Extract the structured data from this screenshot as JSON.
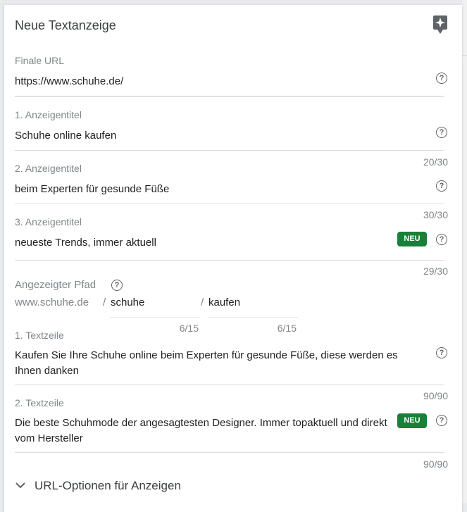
{
  "card": {
    "title": "Neue Textanzeige",
    "assistant_icon": "sparkle-icon"
  },
  "final_url": {
    "label": "Finale URL",
    "value": "https://www.schuhe.de/"
  },
  "headline1": {
    "label": "1. Anzeigentitel",
    "value": "Schuhe online kaufen",
    "counter": "20/30"
  },
  "headline2": {
    "label": "2. Anzeigentitel",
    "value": "beim Experten für gesunde Füße",
    "counter": "30/30"
  },
  "headline3": {
    "label": "3. Anzeigentitel",
    "value": "neueste Trends, immer aktuell",
    "badge": "NEU",
    "counter": "29/30"
  },
  "display_path": {
    "label": "Angezeigter Pfad",
    "domain": "www.schuhe.de",
    "slash": "/",
    "path1": "schuhe",
    "path1_counter": "6/15",
    "path2": "kaufen",
    "path2_counter": "6/15"
  },
  "desc1": {
    "label": "1. Textzeile",
    "value": "Kaufen Sie Ihre Schuhe online beim Experten für gesunde Füße, diese werden es Ihnen danken",
    "counter": "90/90"
  },
  "desc2": {
    "label": "2. Textzeile",
    "value": "Die beste Schuhmode der angesagtesten Designer. Immer topaktuell und direkt vom Hersteller",
    "badge": "NEU",
    "counter": "90/90"
  },
  "url_options": {
    "label": "URL-Optionen für Anzeigen"
  },
  "help_glyph": "?",
  "colors": {
    "badge": "#188038",
    "label": "#80868b",
    "text": "#202124"
  }
}
